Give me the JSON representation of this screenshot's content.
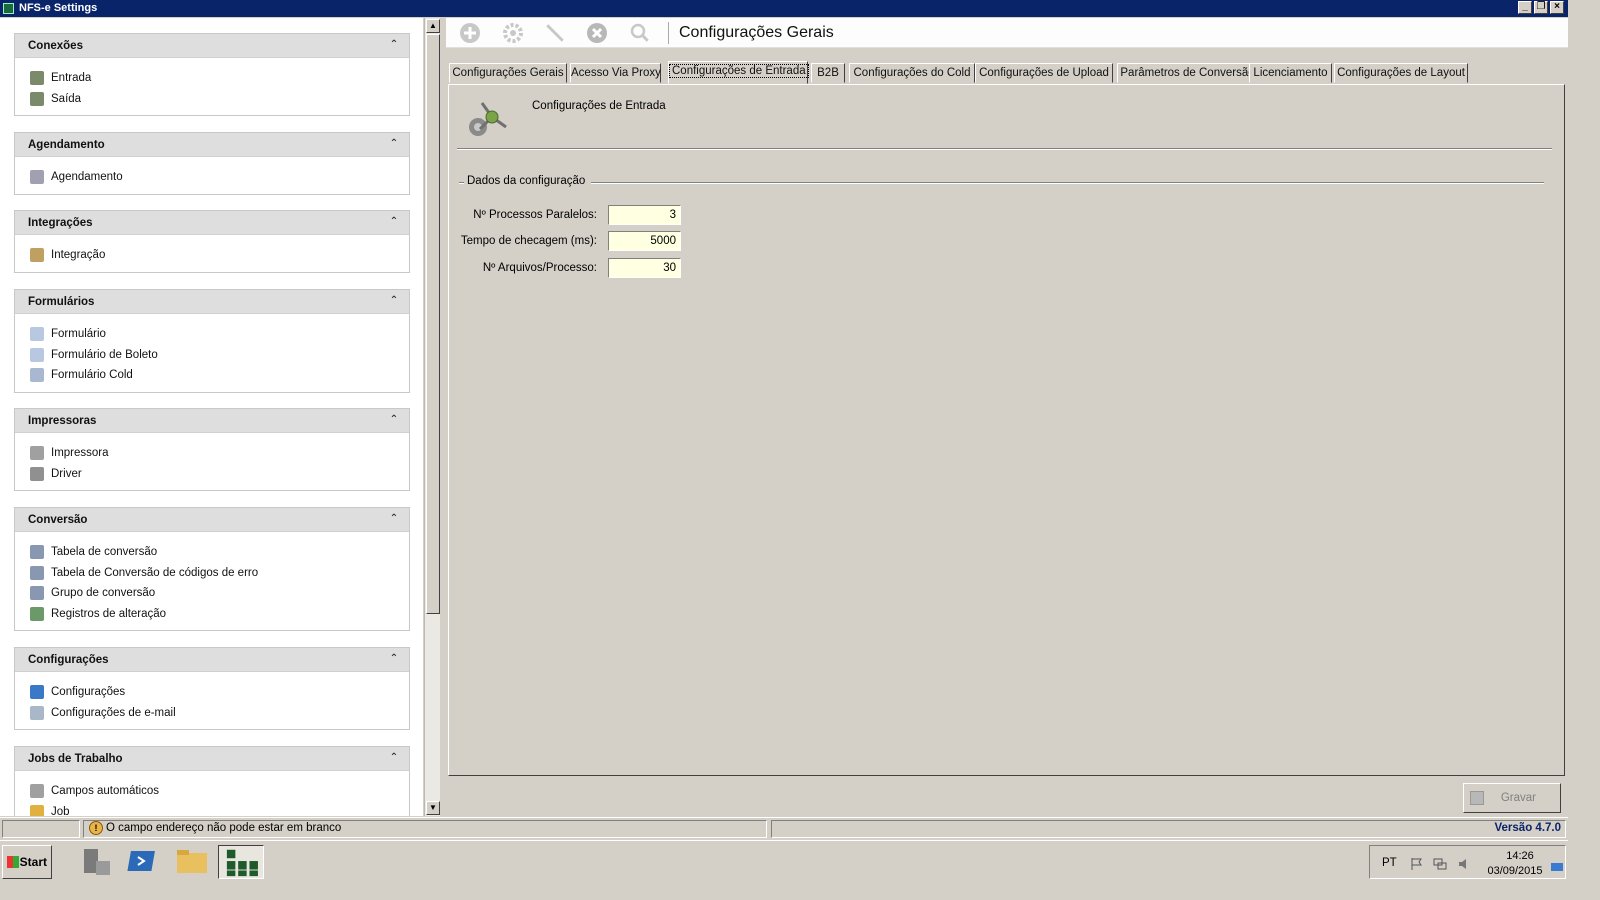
{
  "window": {
    "title": "NFS-e Settings"
  },
  "sidebar": {
    "groups": [
      {
        "title": "Conexões",
        "items": [
          {
            "label": "Entrada",
            "icon": "network-icon"
          },
          {
            "label": "Saída",
            "icon": "network-icon"
          }
        ]
      },
      {
        "title": "Agendamento",
        "items": [
          {
            "label": "Agendamento",
            "icon": "calendar-icon"
          }
        ]
      },
      {
        "title": "Integrações",
        "items": [
          {
            "label": "Integração",
            "icon": "integration-icon"
          }
        ]
      },
      {
        "title": "Formulários",
        "items": [
          {
            "label": "Formulário",
            "icon": "document-icon"
          },
          {
            "label": "Formulário de Boleto",
            "icon": "document-icon"
          },
          {
            "label": "Formulário Cold",
            "icon": "document-edit-icon"
          }
        ]
      },
      {
        "title": "Impressoras",
        "items": [
          {
            "label": "Impressora",
            "icon": "printer-icon"
          },
          {
            "label": "Driver",
            "icon": "driver-icon"
          }
        ]
      },
      {
        "title": "Conversão",
        "items": [
          {
            "label": "Tabela de conversão",
            "icon": "conversion-table-icon"
          },
          {
            "label": "Tabela de Conversão de códigos de erro",
            "icon": "conversion-table-icon"
          },
          {
            "label": "Grupo de conversão",
            "icon": "conversion-table-icon"
          },
          {
            "label": "Registros de alteração",
            "icon": "globe-icon"
          }
        ]
      },
      {
        "title": "Configurações",
        "items": [
          {
            "label": "Configurações",
            "icon": "gear-icon"
          },
          {
            "label": "Configurações de e-mail",
            "icon": "envelope-icon"
          }
        ]
      },
      {
        "title": "Jobs de Trabalho",
        "items": [
          {
            "label": "Campos automáticos",
            "icon": "wand-icon"
          },
          {
            "label": "Job",
            "icon": "user-icon"
          }
        ]
      }
    ]
  },
  "header": {
    "title": "Configurações Gerais"
  },
  "tabs": [
    {
      "label": "Configurações Gerais",
      "active": false
    },
    {
      "label": "Acesso Via Proxy",
      "active": false
    },
    {
      "label": "Configurações de Entrada",
      "active": true
    },
    {
      "label": "B2B",
      "active": false
    },
    {
      "label": "Configurações do Cold",
      "active": false
    },
    {
      "label": "Configurações de Upload",
      "active": false
    },
    {
      "label": "Parâmetros de Conversão",
      "active": false
    },
    {
      "label": "Licenciamento",
      "active": false
    },
    {
      "label": "Configurações de Layout",
      "active": false
    }
  ],
  "panel": {
    "caption": "Configurações de Entrada",
    "section_title": "Dados da configuração",
    "fields": [
      {
        "label": "Nº Processos Paralelos:",
        "value": "3"
      },
      {
        "label": "Tempo de checagem (ms):",
        "value": "5000"
      },
      {
        "label": "Nº Arquivos/Processo:",
        "value": "30"
      }
    ],
    "save_label": "Gravar"
  },
  "statusbar": {
    "message": "O campo endereço não pode estar em branco",
    "version": "Versão 4.7.0"
  },
  "taskbar": {
    "start_label": "Start",
    "language": "PT",
    "time": "14:26",
    "date": "03/09/2015"
  },
  "colors": {
    "titlebar": "#0a246a",
    "input_bg": "#ffffe1",
    "version_text": "#0a246a"
  }
}
